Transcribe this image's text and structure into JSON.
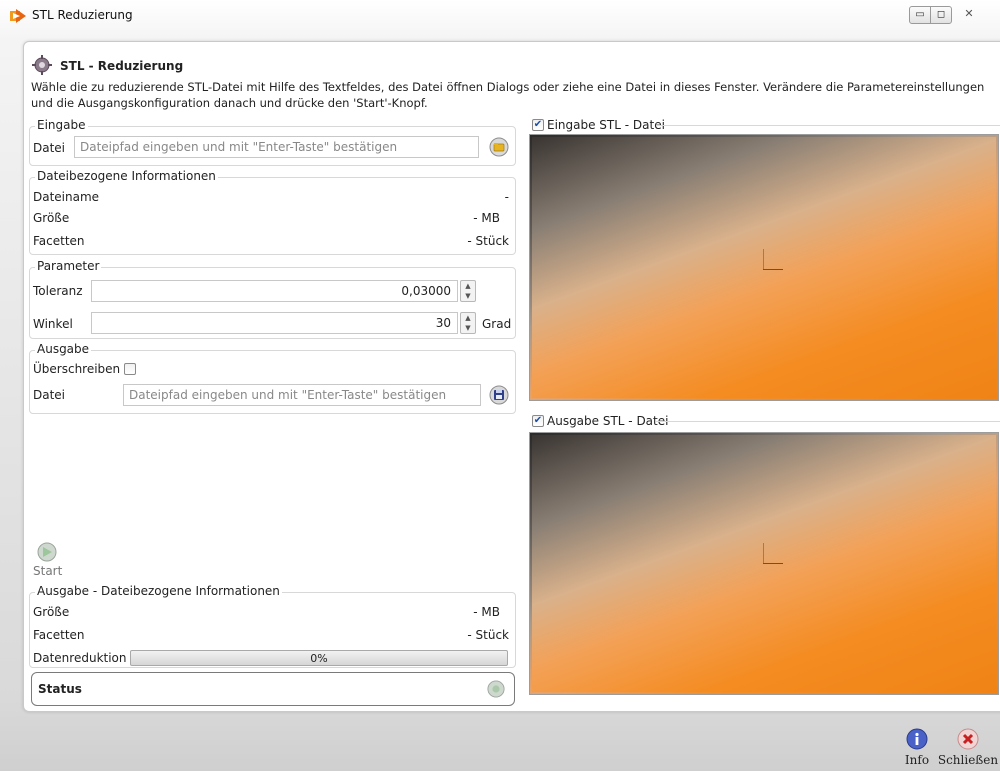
{
  "window": {
    "title": "STL Reduzierung",
    "minimize_glyph": "▭",
    "maximize_glyph": "◻",
    "close_glyph": "✕"
  },
  "header": {
    "title": "STL - Reduzierung",
    "description": "Wähle die zu reduzierende STL-Datei mit Hilfe des Textfeldes, des Datei öffnen Dialogs oder ziehe eine Datei in dieses Fenster. Verändere die Parametereinstellungen und die Ausgangskonfiguration danach und drücke den 'Start'-Knopf."
  },
  "eingabe": {
    "group_label": "Eingabe",
    "datei_label": "Datei",
    "datei_placeholder": "Dateipfad eingeben und mit \"Enter-Taste\" bestätigen",
    "open_icon": "folder-open-icon"
  },
  "dateiinfo": {
    "group_label": "Dateibezogene Informationen",
    "rows": [
      {
        "label": "Dateiname",
        "value": "-"
      },
      {
        "label": "Größe",
        "value": "- MB"
      },
      {
        "label": "Facetten",
        "value": "- Stück"
      }
    ]
  },
  "parameter": {
    "group_label": "Parameter",
    "toleranz_label": "Toleranz",
    "toleranz_value": "0,03000",
    "winkel_label": "Winkel",
    "winkel_value": "30",
    "winkel_unit": "Grad"
  },
  "ausgabe": {
    "group_label": "Ausgabe",
    "overwrite_label": "Überschreiben",
    "overwrite_checked": false,
    "datei_label": "Datei",
    "datei_placeholder": "Dateipfad eingeben und mit \"Enter-Taste\" bestätigen",
    "save_icon": "save-disk-icon"
  },
  "start": {
    "label": "Start",
    "icon": "play-arrow-icon"
  },
  "ausgabe_info": {
    "group_label": "Ausgabe - Dateibezogene Informationen",
    "groesse_label": "Größe",
    "groesse_value": "- MB",
    "facetten_label": "Facetten",
    "facetten_value": "- Stück",
    "reduktion_label": "Datenreduktion",
    "reduktion_text": "0%",
    "reduktion_fraction": 0
  },
  "status": {
    "label": "Status",
    "icon": "status-indicator-icon"
  },
  "viewers": {
    "input_label": "Eingabe STL - Datei",
    "input_checked": true,
    "output_label": "Ausgabe STL - Datei",
    "output_checked": true
  },
  "footer": {
    "info_label": "Info",
    "close_label": "Schließen"
  },
  "colors": {
    "accent_orange": "#f08417",
    "axis_x": "#d42020",
    "axis_y": "#3ab53a"
  }
}
